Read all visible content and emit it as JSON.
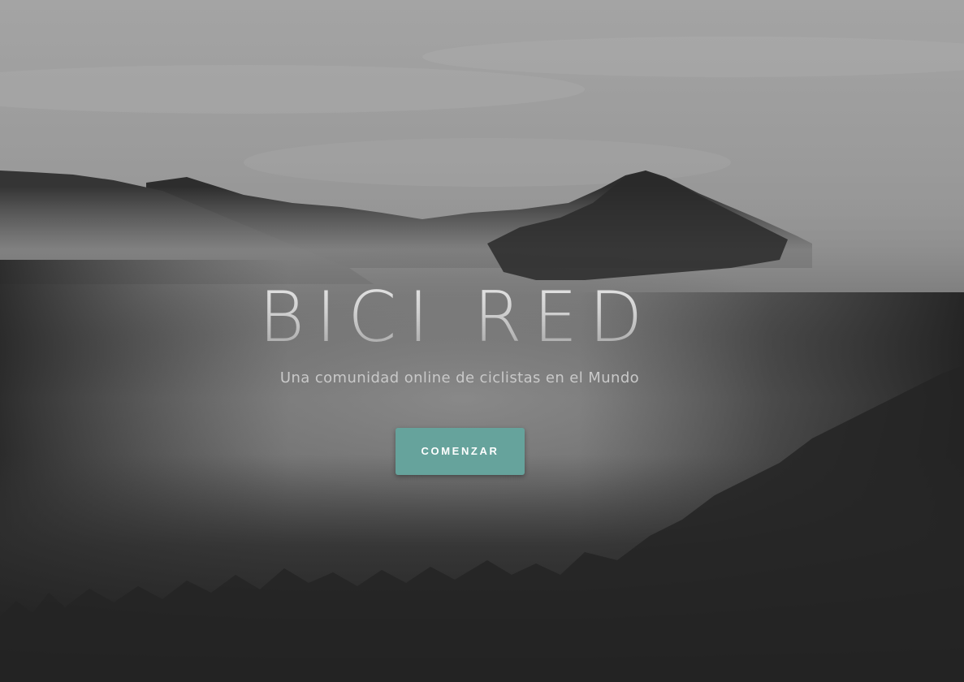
{
  "hero": {
    "title": "BICI RED",
    "subtitle": "Una comunidad online de ciclistas en el Mundo",
    "cta_label": "COMENZAR",
    "background_image": "foggy-mountains-forest-grayscale"
  },
  "colors": {
    "button_bg": "#66a39c",
    "button_text": "#ffffff",
    "subtitle_text": "#c9c9c9",
    "title_text": "#d8d8d8"
  }
}
